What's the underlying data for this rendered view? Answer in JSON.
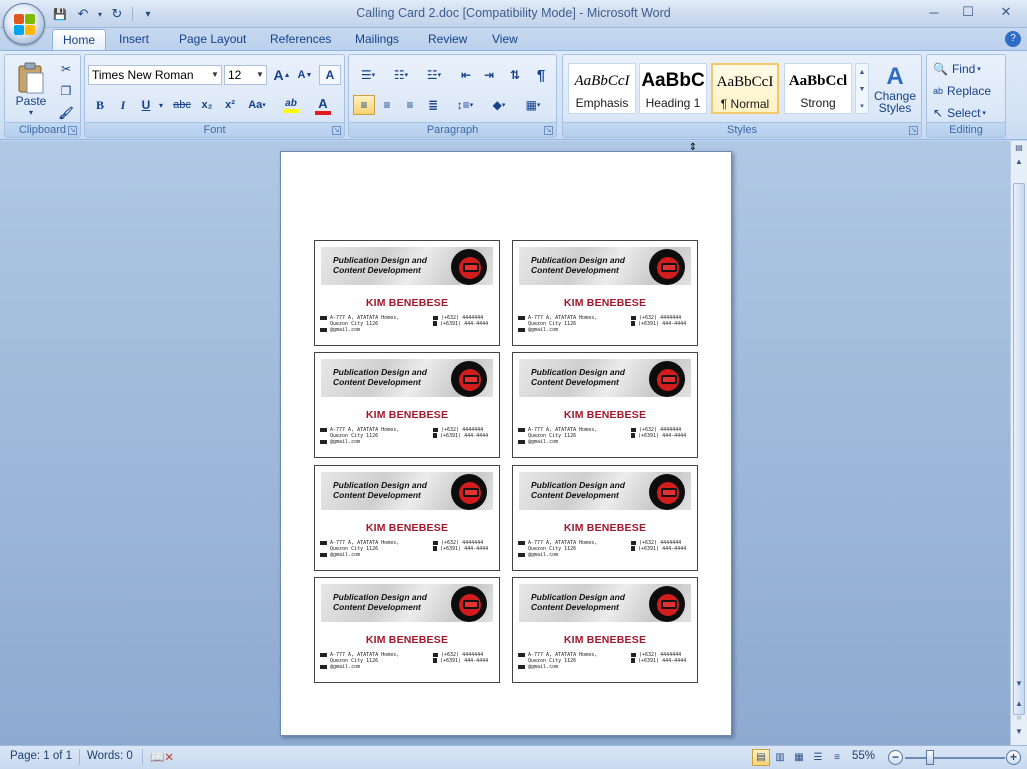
{
  "window": {
    "title": "Calling Card 2.doc [Compatibility Mode] - Microsoft Word",
    "controls": {
      "minimize": "─",
      "maximize": "☐",
      "close": "✕"
    }
  },
  "quick_access": {
    "save": "💾",
    "undo": "↶",
    "redo": "↻",
    "customize": "▾"
  },
  "tabs": [
    "Home",
    "Insert",
    "Page Layout",
    "References",
    "Mailings",
    "Review",
    "View"
  ],
  "active_tab": "Home",
  "ribbon": {
    "clipboard": {
      "label": "Clipboard",
      "paste": "Paste"
    },
    "font": {
      "label": "Font",
      "font_name": "Times New Roman",
      "font_size": "12",
      "grow": "A",
      "shrink": "A",
      "clear": "A",
      "bold": "B",
      "italic": "I",
      "underline": "U",
      "strike": "abc",
      "subscript": "x₂",
      "superscript": "x²",
      "change_case": "Aa",
      "highlight": "ab",
      "font_color": "A"
    },
    "paragraph": {
      "label": "Paragraph",
      "pilcrow": "¶"
    },
    "styles": {
      "label": "Styles",
      "items": [
        {
          "sample": "AaBbCcI",
          "name": "Emphasis"
        },
        {
          "sample": "AaBbC",
          "name": "Heading 1"
        },
        {
          "sample": "AaBbCcI",
          "name": "¶ Normal"
        },
        {
          "sample": "AaBbCcl",
          "name": "Strong"
        }
      ],
      "change_styles": "Change Styles",
      "change_styles_line1": "Change",
      "change_styles_line2": "Styles"
    },
    "editing": {
      "label": "Editing",
      "find": "Find",
      "replace": "Replace",
      "select": "Select"
    }
  },
  "cards": {
    "title_line1": "Publication Design and",
    "title_line2": "Content Development",
    "name": "KIM BENEBESE",
    "address_line1": "A-777 A, ATATATA Homes,",
    "address_line2": "Quezon City 1126",
    "email": "@gmail.com",
    "phone1": "(+632) 4444444",
    "phone2": "(+6391) 444-4444"
  },
  "status": {
    "page": "Page: 1 of 1",
    "words": "Words: 0",
    "zoom": "55%"
  },
  "colors": {
    "accent": "#15428b",
    "card_name": "#a2182d",
    "logo_red": "#d11d1d"
  }
}
